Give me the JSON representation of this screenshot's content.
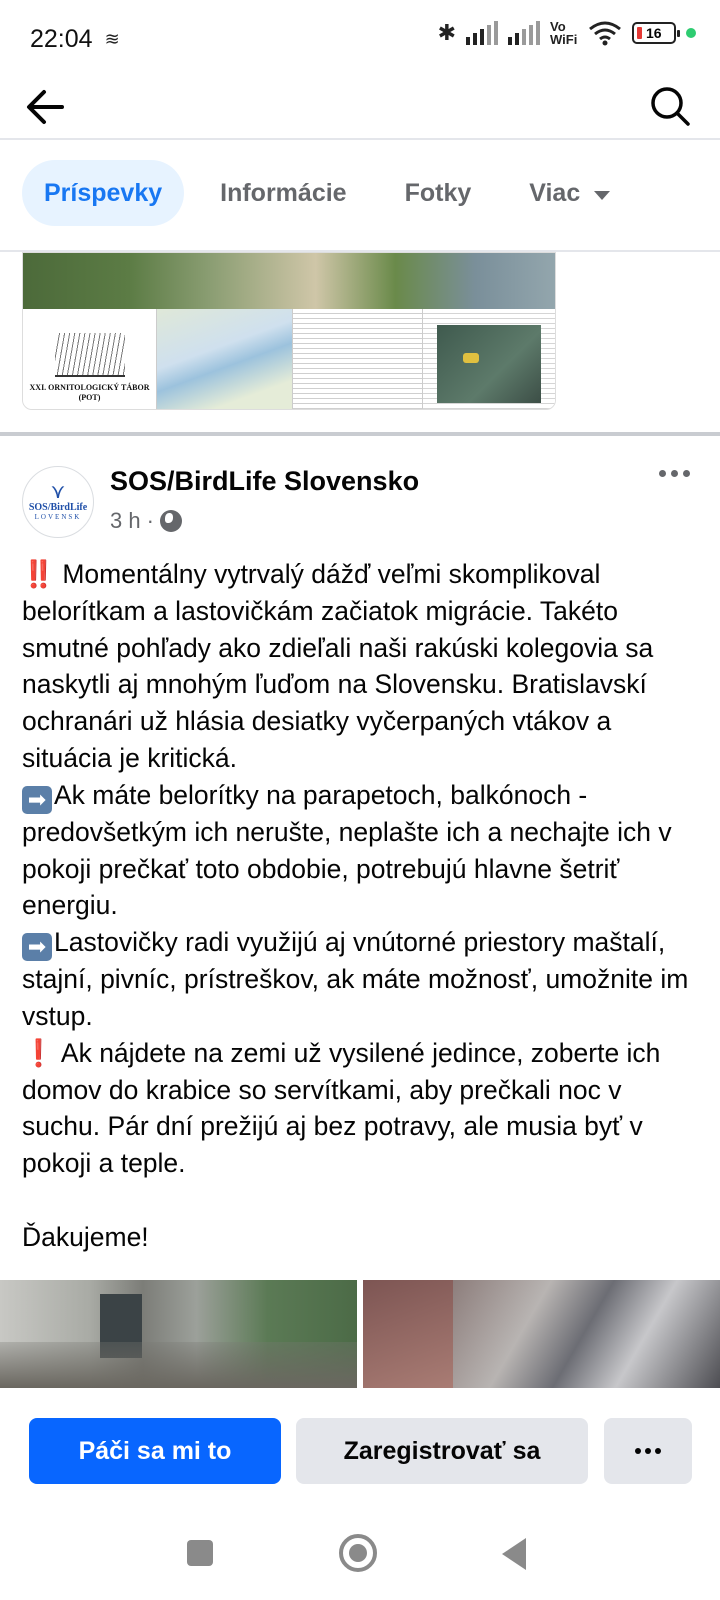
{
  "status_bar": {
    "time": "22:04",
    "vowifi_line1": "Vo",
    "vowifi_line2": "WiFi",
    "battery": "16",
    "icons": [
      "stack-icon",
      "bluetooth-icon",
      "signal-icon",
      "signal-icon",
      "wifi-icon",
      "battery-icon",
      "dot-icon"
    ]
  },
  "nav": {
    "back_icon": "arrow-left-icon",
    "search_icon": "search-icon"
  },
  "tabs": [
    {
      "label": "Príspevky",
      "active": true
    },
    {
      "label": "Informácie",
      "active": false
    },
    {
      "label": "Fotky",
      "active": false
    },
    {
      "label": "Viac",
      "active": false
    }
  ],
  "previous_post": {
    "doc_title_1": "XXI. ORNITOLOGICKÝ TÁBOR",
    "doc_title_2": "(POT)"
  },
  "post": {
    "page_name": "SOS/BirdLife Slovensko",
    "time": "3 h",
    "separator": "·",
    "avatar_name": "SOS/BirdLife",
    "avatar_sub": "LOVENSK",
    "paragraphs": [
      {
        "prefix": "‼️",
        "text": " Momentálny vytrvalý dážď veľmi skomplikoval belorítkam a lastovičkám začiatok migrácie. Takéto smutné pohľady ako zdieľali naši rakúski kolegovia sa naskytli aj mnohým ľuďom na Slovensku. Bratislavskí ochranári už hlásia desiatky vyčerpaných vtákov a situácia je kritická."
      },
      {
        "prefix": "➡",
        "text": "Ak máte belorítky na parapetoch, balkónoch - predovšetkým ich nerušte, neplašte ich a nechajte ich v pokoji prečkať toto obdobie, potrebujú hlavne šetriť energiu."
      },
      {
        "prefix": "➡",
        "text": "Lastovičky radi využijú aj vnútorné priestory maštalí, stajní, pivníc, prístreškov, ak máte možnosť, umožnite im vstup."
      },
      {
        "prefix": "❗",
        "text": " Ak nájdete na zemi už vysilené jedince, zoberte ich domov do krabice so servítkami, aby prečkali noc v suchu. Pár dní prežijú aj bez potravy, ale musia byť v pokoji a teple."
      }
    ],
    "closing": "Ďakujeme!"
  },
  "actions": {
    "like": "Páči sa mi to",
    "register": "Zaregistrovať sa",
    "more_icon": "more-icon"
  },
  "colors": {
    "primary": "#0866ff",
    "tab_active_bg": "#e7f3ff",
    "tab_active_text": "#1877f2",
    "secondary_bg": "#e4e6eb",
    "muted_text": "#65676b"
  }
}
